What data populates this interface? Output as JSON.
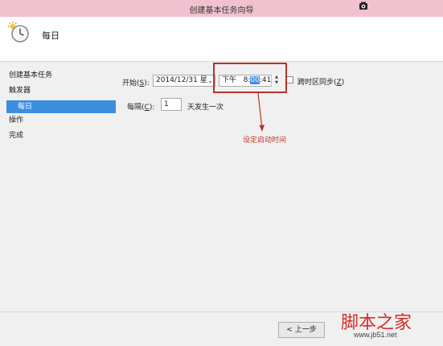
{
  "window": {
    "title": "创建基本任务向导"
  },
  "header": {
    "icon": "clock-icon",
    "title": "每日"
  },
  "sidebar": {
    "items": [
      {
        "label": "创建基本任务",
        "active": false
      },
      {
        "label": "触发器",
        "active": false
      },
      {
        "label": "每日",
        "active": true
      },
      {
        "label": "操作",
        "active": false
      },
      {
        "label": "完成",
        "active": false
      }
    ]
  },
  "form": {
    "start_label_pre": "开始(",
    "start_label_key": "S",
    "start_label_post": "):",
    "start_date": "2014/12/31 星",
    "time_ampm": "下午",
    "time_hour": "8:",
    "time_minute": "00",
    "time_second": ":41",
    "sync_label_pre": "跨时区同步(",
    "sync_label_key": "Z",
    "sync_label_post": ")",
    "sync_checked": false,
    "repeat_label_pre": "每隔(",
    "repeat_label_key": "C",
    "repeat_label_post": "):",
    "repeat_value": "1",
    "repeat_unit": "天发生一次"
  },
  "annotation": {
    "text": "设定启动时间",
    "color": "#c0392b"
  },
  "footer": {
    "back_label": "< 上一步"
  },
  "watermark": {
    "main": "脚本之家",
    "sub": "www.jb51.net"
  },
  "colors": {
    "titlebar": "#f0c2cf",
    "accent": "#3d8ee0",
    "highlight": "#b5332b"
  }
}
